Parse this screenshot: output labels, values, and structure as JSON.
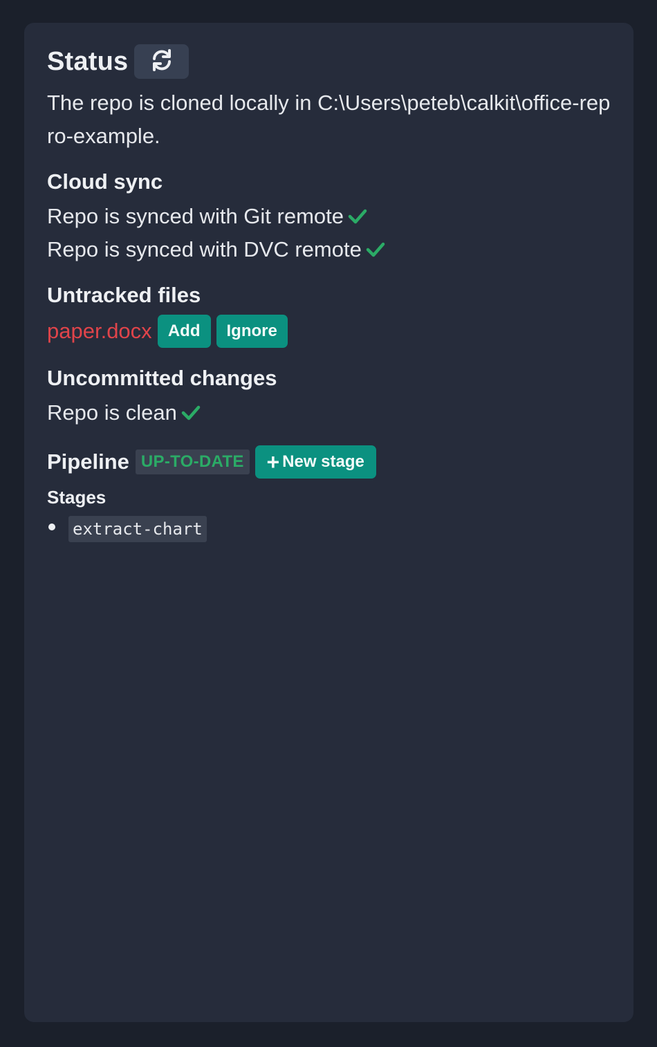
{
  "status": {
    "title": "Status",
    "refresh_icon": "refresh-icon",
    "description": "The repo is cloned locally in C:\\Users\\peteb\\calkit\\office-repro-example."
  },
  "cloud_sync": {
    "heading": "Cloud sync",
    "git_text": "Repo is synced with Git remote",
    "dvc_text": "Repo is synced with DVC remote"
  },
  "untracked": {
    "heading": "Untracked files",
    "file": "paper.docx",
    "add_label": "Add",
    "ignore_label": "Ignore"
  },
  "uncommitted": {
    "heading": "Uncommitted changes",
    "text": "Repo is clean"
  },
  "pipeline": {
    "heading": "Pipeline",
    "badge": "UP-TO-DATE",
    "new_stage_plus": "+",
    "new_stage_label": "New stage",
    "stages_heading": "Stages",
    "stages": [
      "extract-chart"
    ]
  },
  "colors": {
    "background": "#1b202b",
    "card": "#262c3b",
    "accent_teal": "#0b9180",
    "check_green": "#2bab66",
    "untracked_red": "#e0444a"
  }
}
